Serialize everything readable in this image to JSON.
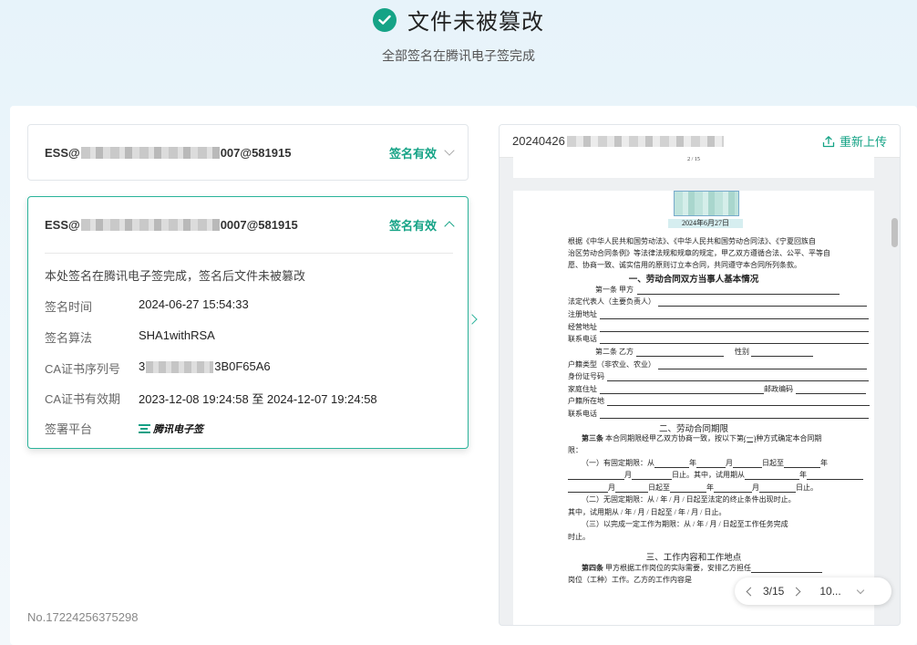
{
  "header": {
    "title": "文件未被篡改",
    "subtitle": "全部签名在腾讯电子签完成"
  },
  "signers": [
    {
      "id_prefix": "ESS@",
      "id_suffix": "007@581915",
      "status": "签名有效",
      "expanded": false
    },
    {
      "id_prefix": "ESS@",
      "id_suffix": "0007@581915",
      "status": "签名有效",
      "expanded": true,
      "description": "本处签名在腾讯电子签完成，签名后文件未被篡改",
      "details": [
        {
          "label": "签名时间",
          "value": "2024-06-27 15:54:33"
        },
        {
          "label": "签名算法",
          "value": "SHA1withRSA"
        },
        {
          "label": "CA证书序列号",
          "value_prefix": "3",
          "value_suffix": "3B0F65A6"
        },
        {
          "label": "CA证书有效期",
          "value": "2023-12-08 19:24:58 至 2024-12-07 19:24:58"
        },
        {
          "label": "签署平台",
          "value": "腾讯电子签"
        }
      ]
    }
  ],
  "doc_number": "No.17224256375298",
  "preview": {
    "file_name_prefix": "20240426",
    "reupload_label": "重新上传",
    "prev_page_number": "2 / 15",
    "stamp_date": "2024年6月27日",
    "page_indicator": "3/15",
    "zoom": "10...",
    "doc": {
      "intro_1": "根据《中华人民共和国劳动法》、《中华人民共和国劳动合同法》、《宁夏回族自",
      "intro_2": "治区劳动合同条例》等法律法规和规章的规定，甲乙双方遵循合法、公平、平等自",
      "intro_3": "愿、协商一致、诚实信用的原则订立本合同，共同遵守本合同所列条款。",
      "section_1": "一、劳动合同双方当事人基本情况",
      "art1": "第一条    甲方",
      "legal_rep": "法定代表人（主要负责人）",
      "reg_addr": "注册地址",
      "biz_addr": "经营地址",
      "contact": "联系电话",
      "art2": "第二条    乙方",
      "gender": "性别",
      "hukou_type": "户籍类型（非农业、农业）",
      "id_no": "身份证号码",
      "home_addr": "家庭住址",
      "postcode": "邮政编码",
      "hukou_loc": "户籍所在地",
      "contact2": "联系电话",
      "section_2": "二、劳动合同期限",
      "art3_label": "第三条",
      "art3_text": "本合同期限经甲乙双方协商一致，按以下第",
      "art3_choice": "(一)",
      "art3_tail": "种方式确定本合同期",
      "art3_tail2": "限：",
      "term1": "（一）有固定期限：从",
      "term1_year": "年",
      "term1_month": "月",
      "term1_day_to": "日起至",
      "term1_year2": "年",
      "term1b_month": "月",
      "term1b_text": "日止。其中，试用期从",
      "term1b_year": "年",
      "term1c_month": "月",
      "term1c_day_to": "日起至",
      "term1c_year": "年",
      "term1c_month2": "月",
      "term1c_day": "日止。",
      "term2": "（二）无固定期限：从  /  年  /  月  /  日起至法定的终止条件出现时止。",
      "term2b": "其中，试用期从  /  年  /  月  /  日起至  /  年  /  月  /  日止。",
      "term3": "（三）以完成一定工作为期限：从  /  年  /  月  /  日起至工作任务完成",
      "term3b": "时止。",
      "section_3": "三、工作内容和工作地点",
      "art4_label": "第四条",
      "art4_text": "甲方根据工作岗位的实际需要，安排乙方担任",
      "art4b": "岗位（工种）工作。乙方的工作内容是"
    }
  }
}
